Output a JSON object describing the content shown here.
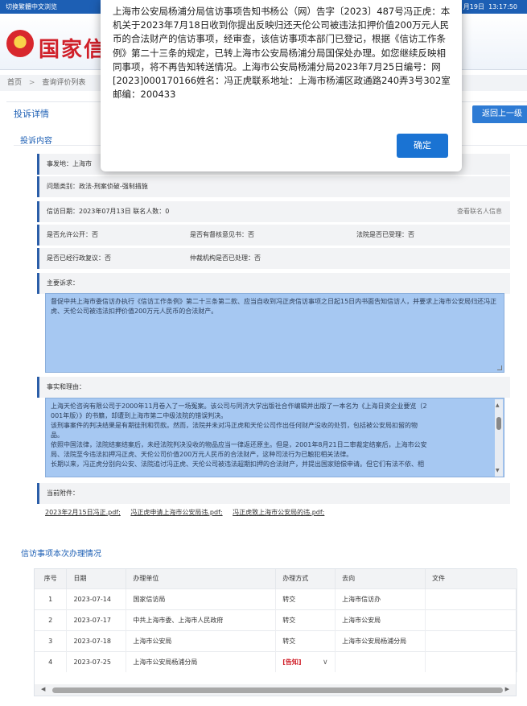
{
  "topbar": {
    "left": "切换繁體中文浏览",
    "right_date": "月19日",
    "right_time": "13:17:50"
  },
  "banner": {
    "site_name": "国家信"
  },
  "breadcrumb": {
    "home": "首页",
    "sep": ">",
    "current": "查询评价列表"
  },
  "detail": {
    "tab": "投诉详情",
    "back_button": "返回上一级",
    "section_title": "投诉内容",
    "location_label": "事发地：上海市",
    "category": "问题类别：政法-刑案侦破-强制措施",
    "date_label": "信访日期：2023年07月13日  联名人数：0",
    "view_contacts": "查看联名人信息",
    "public_label": "是否允许公开：否",
    "review_label": "是否有督核意见书：否",
    "court_label": "法院是否已受理：否",
    "reconsider_label": "是否已经行政复议：否",
    "arbitration_label": "仲裁机构是否已处理：否",
    "main_request_label": "主要诉求：",
    "main_request_text": "督促中共上海市委信访办执行《信访工作条例》第二十三条第二款、应当自收到冯正虎信访事项之日起15日内书面告知信访人，并要求上海市公安局归还冯正虎、天伦公司被违法扣押价值200万元人民币的合法财产。",
    "facts_label": "事实和理由：",
    "facts_lines": [
      "上海天伦咨询有限公司于2000年11月卷入了一场冤案。该公司与同济大学出版社合作编辑并出版了一本名为《上海日资企业要览（2",
      "001年版）》的书籍，却遭到上海市第二中级法院的错误判决。",
      "该刑事案件的判决结果是有期徒刑和罚款。然而，法院并未对冯正虎和天伦公司作出任何财产没收的处罚，包括被公安局扣留的物",
      "品。",
      "依照中国法律，法院结案结案后，未经法院判决没收的物品应当一律返还原主。但是，2001年8月21日二审裁定结案后，上海市公安",
      "局、法院至今违法扣押冯正虎、天伦公司价值200万元人民币的合法财产，这种司法行为已触犯相关法律。",
      "长期以来，冯正虎分别向公安、法院追讨冯正虎、天伦公司被违法超期扣押的合法财产，并提出国家赔偿申请。但它们有法不依、相"
    ],
    "attachments_label": "当前附件：",
    "attachments": [
      "2023年2月15日冯正.pdf;",
      "冯正虎申请上海市公安局违.pdf;",
      "冯正虎致上海市公安局的违.pdf;"
    ]
  },
  "progress": {
    "section_title": "信访事项本次办理情况",
    "columns": [
      "序号",
      "日期",
      "办理单位",
      "办理方式",
      "去向",
      "文件"
    ],
    "rows": [
      {
        "no": "1",
        "date": "2023-07-14",
        "unit": "国家信访局",
        "method": "转交",
        "dest": "上海市信访办",
        "file": ""
      },
      {
        "no": "2",
        "date": "2023-07-17",
        "unit": "中共上海市委、上海市人民政府",
        "method": "转交",
        "dest": "上海市公安局",
        "file": ""
      },
      {
        "no": "3",
        "date": "2023-07-18",
        "unit": "上海市公安局",
        "method": "转交",
        "dest": "上海市公安局杨浦分局",
        "file": ""
      },
      {
        "no": "4",
        "date": "2023-07-25",
        "unit": "上海市公安局杨浦分局",
        "method": "[告知]",
        "dest": "",
        "file": ""
      }
    ]
  },
  "modal": {
    "message": "上海市公安局杨浦分局信访事项告知书杨公（网）告字〔2023〕487号冯正虎：本机关于2023年7月18日收到你提出反映归还天伦公司被违法扣押价值200万元人民币的合法财产的信访事项，经审查，该信访事项本部门已登记，根据《信访工作条例》第二十三条的规定，已转上海市公安局杨浦分局国保处办理。如您继续反映相同事项，将不再告知转送情况。上海市公安局杨浦分局2023年7月25日编号：网[2023]000170166姓名：冯正虎联系地址：上海市杨浦区政通路240弄3号302室邮编：200433",
    "ok_button": "确定"
  },
  "colors": {
    "accent": "#1d5fb4",
    "button": "#1a73d3",
    "highlight_box": "#a6c8f2",
    "inform_red": "#d0202a"
  }
}
